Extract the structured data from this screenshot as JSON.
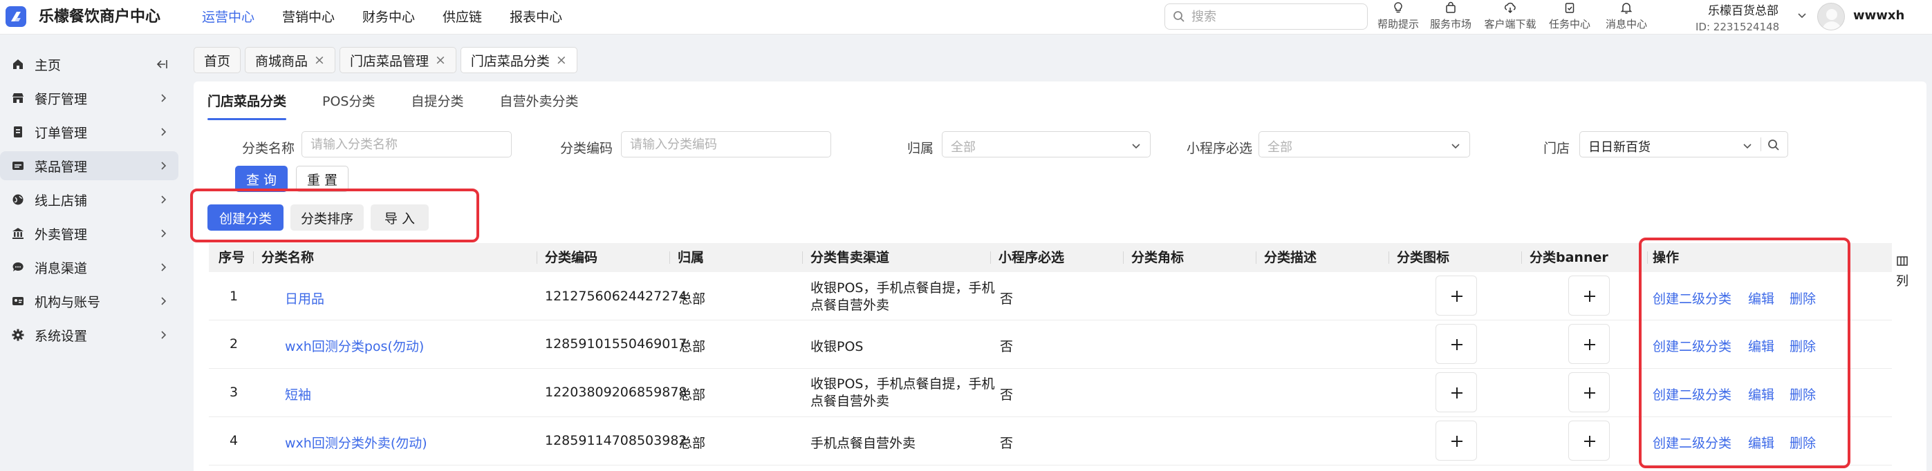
{
  "app": {
    "brand": "乐檬餐饮商户中心"
  },
  "topnav": [
    {
      "label": "运营中心",
      "active": true
    },
    {
      "label": "营销中心",
      "active": false
    },
    {
      "label": "财务中心",
      "active": false
    },
    {
      "label": "供应链",
      "active": false
    },
    {
      "label": "报表中心",
      "active": false
    }
  ],
  "search": {
    "placeholder": "搜索",
    "value": ""
  },
  "quick_links": [
    {
      "label": "帮助提示",
      "icon": "bulb-icon"
    },
    {
      "label": "服务市场",
      "icon": "shop-bag-icon"
    },
    {
      "label": "客户端下载",
      "icon": "download-cloud-icon"
    },
    {
      "label": "任务中心",
      "icon": "clipboard-icon"
    },
    {
      "label": "消息中心",
      "icon": "bell-icon"
    }
  ],
  "account": {
    "org": "乐檬百货总部",
    "id": "ID: 2231524148",
    "username": "wwwxh"
  },
  "sidebar": {
    "items": [
      {
        "label": "主页",
        "icon": "home-icon"
      },
      {
        "label": "餐厅管理",
        "icon": "store-icon"
      },
      {
        "label": "订单管理",
        "icon": "order-icon"
      },
      {
        "label": "菜品管理",
        "icon": "dish-icon",
        "active": true
      },
      {
        "label": "线上店铺",
        "icon": "globe-icon"
      },
      {
        "label": "外卖管理",
        "icon": "bank-icon"
      },
      {
        "label": "消息渠道",
        "icon": "chat-icon"
      },
      {
        "label": "机构与账号",
        "icon": "id-card-icon"
      },
      {
        "label": "系统设置",
        "icon": "gear-icon"
      }
    ]
  },
  "page_tabs": [
    {
      "label": "首页",
      "closable": false
    },
    {
      "label": "商城商品",
      "closable": true
    },
    {
      "label": "门店菜品管理",
      "closable": true
    },
    {
      "label": "门店菜品分类",
      "closable": true,
      "active": true
    }
  ],
  "close_glyph": "×",
  "sub_tabs": [
    {
      "label": "门店菜品分类",
      "active": true
    },
    {
      "label": "POS分类"
    },
    {
      "label": "自提分类"
    },
    {
      "label": "自营外卖分类"
    }
  ],
  "filters": {
    "name": {
      "label": "分类名称",
      "placeholder": "请输入分类名称",
      "value": ""
    },
    "code": {
      "label": "分类编码",
      "placeholder": "请输入分类编码",
      "value": ""
    },
    "belong": {
      "label": "归属",
      "value": "全部"
    },
    "mini_required": {
      "label": "小程序必选",
      "value": "全部"
    },
    "store": {
      "label": "门店",
      "value": "日日新百货"
    }
  },
  "buttons": {
    "query": "查 询",
    "reset": "重 置",
    "create": "创建分类",
    "sort": "分类排序",
    "import": "导 入"
  },
  "table": {
    "columns": [
      "序号",
      "分类名称",
      "分类编码",
      "归属",
      "分类售卖渠道",
      "小程序必选",
      "分类角标",
      "分类描述",
      "分类图标",
      "分类banner",
      "操作"
    ],
    "rows": [
      {
        "index": "1",
        "name": "日用品",
        "code": "12127560624427274",
        "belong": "总部",
        "channel": "收银POS，手机点餐自提，手机点餐自营外卖",
        "mini_required": "否",
        "badge": "",
        "desc": ""
      },
      {
        "index": "2",
        "name": "wxh回测分类pos(勿动)",
        "code": "12859101550469017",
        "belong": "总部",
        "channel": "收银POS",
        "mini_required": "否",
        "badge": "",
        "desc": ""
      },
      {
        "index": "3",
        "name": "短袖",
        "code": "12203809206859878",
        "belong": "总部",
        "channel": "收银POS，手机点餐自提，手机点餐自营外卖",
        "mini_required": "否",
        "badge": "",
        "desc": ""
      },
      {
        "index": "4",
        "name": "wxh回测分类外卖(勿动)",
        "code": "12859114708503982",
        "belong": "总部",
        "channel": "手机点餐自营外卖",
        "mini_required": "否",
        "badge": "",
        "desc": ""
      }
    ],
    "actions": [
      "创建二级分类",
      "编辑",
      "删除"
    ],
    "column_settings_label": "列"
  },
  "colors": {
    "accent": "#3f6be8",
    "link": "#3d6ae8",
    "highlight": "#e8313a"
  }
}
